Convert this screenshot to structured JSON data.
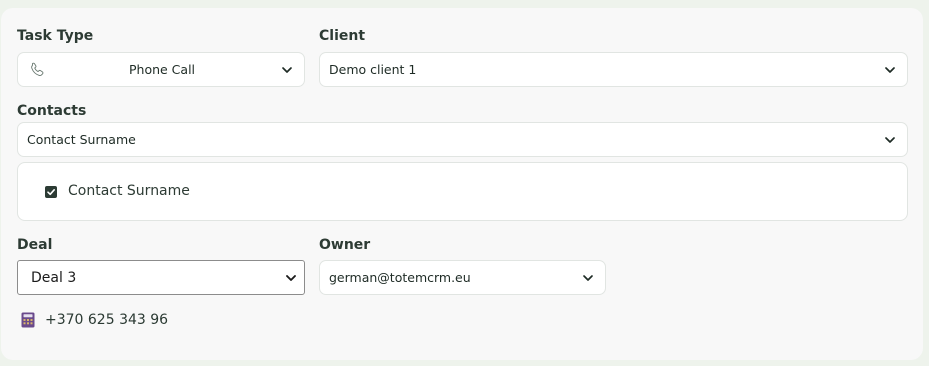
{
  "task_type": {
    "label": "Task Type",
    "value": "Phone Call",
    "icon": "phone-icon"
  },
  "client": {
    "label": "Client",
    "value": "Demo client 1"
  },
  "contacts": {
    "label": "Contacts",
    "value": "Contact Surname",
    "options": [
      {
        "label": "Contact Surname",
        "checked": true
      }
    ]
  },
  "deal": {
    "label": "Deal",
    "value": "Deal 3"
  },
  "owner": {
    "label": "Owner",
    "value": "german@totemcrm.eu"
  },
  "phone": {
    "number": "+370 625 343 96",
    "icon": "calculator-icon"
  },
  "colors": {
    "background": "#eef3ec",
    "card": "#f8f8f8",
    "text": "#2d3b34",
    "border": "#e1e5e2",
    "checkbox": "#2c3b34",
    "icon_purple": "#6a4a8c"
  }
}
